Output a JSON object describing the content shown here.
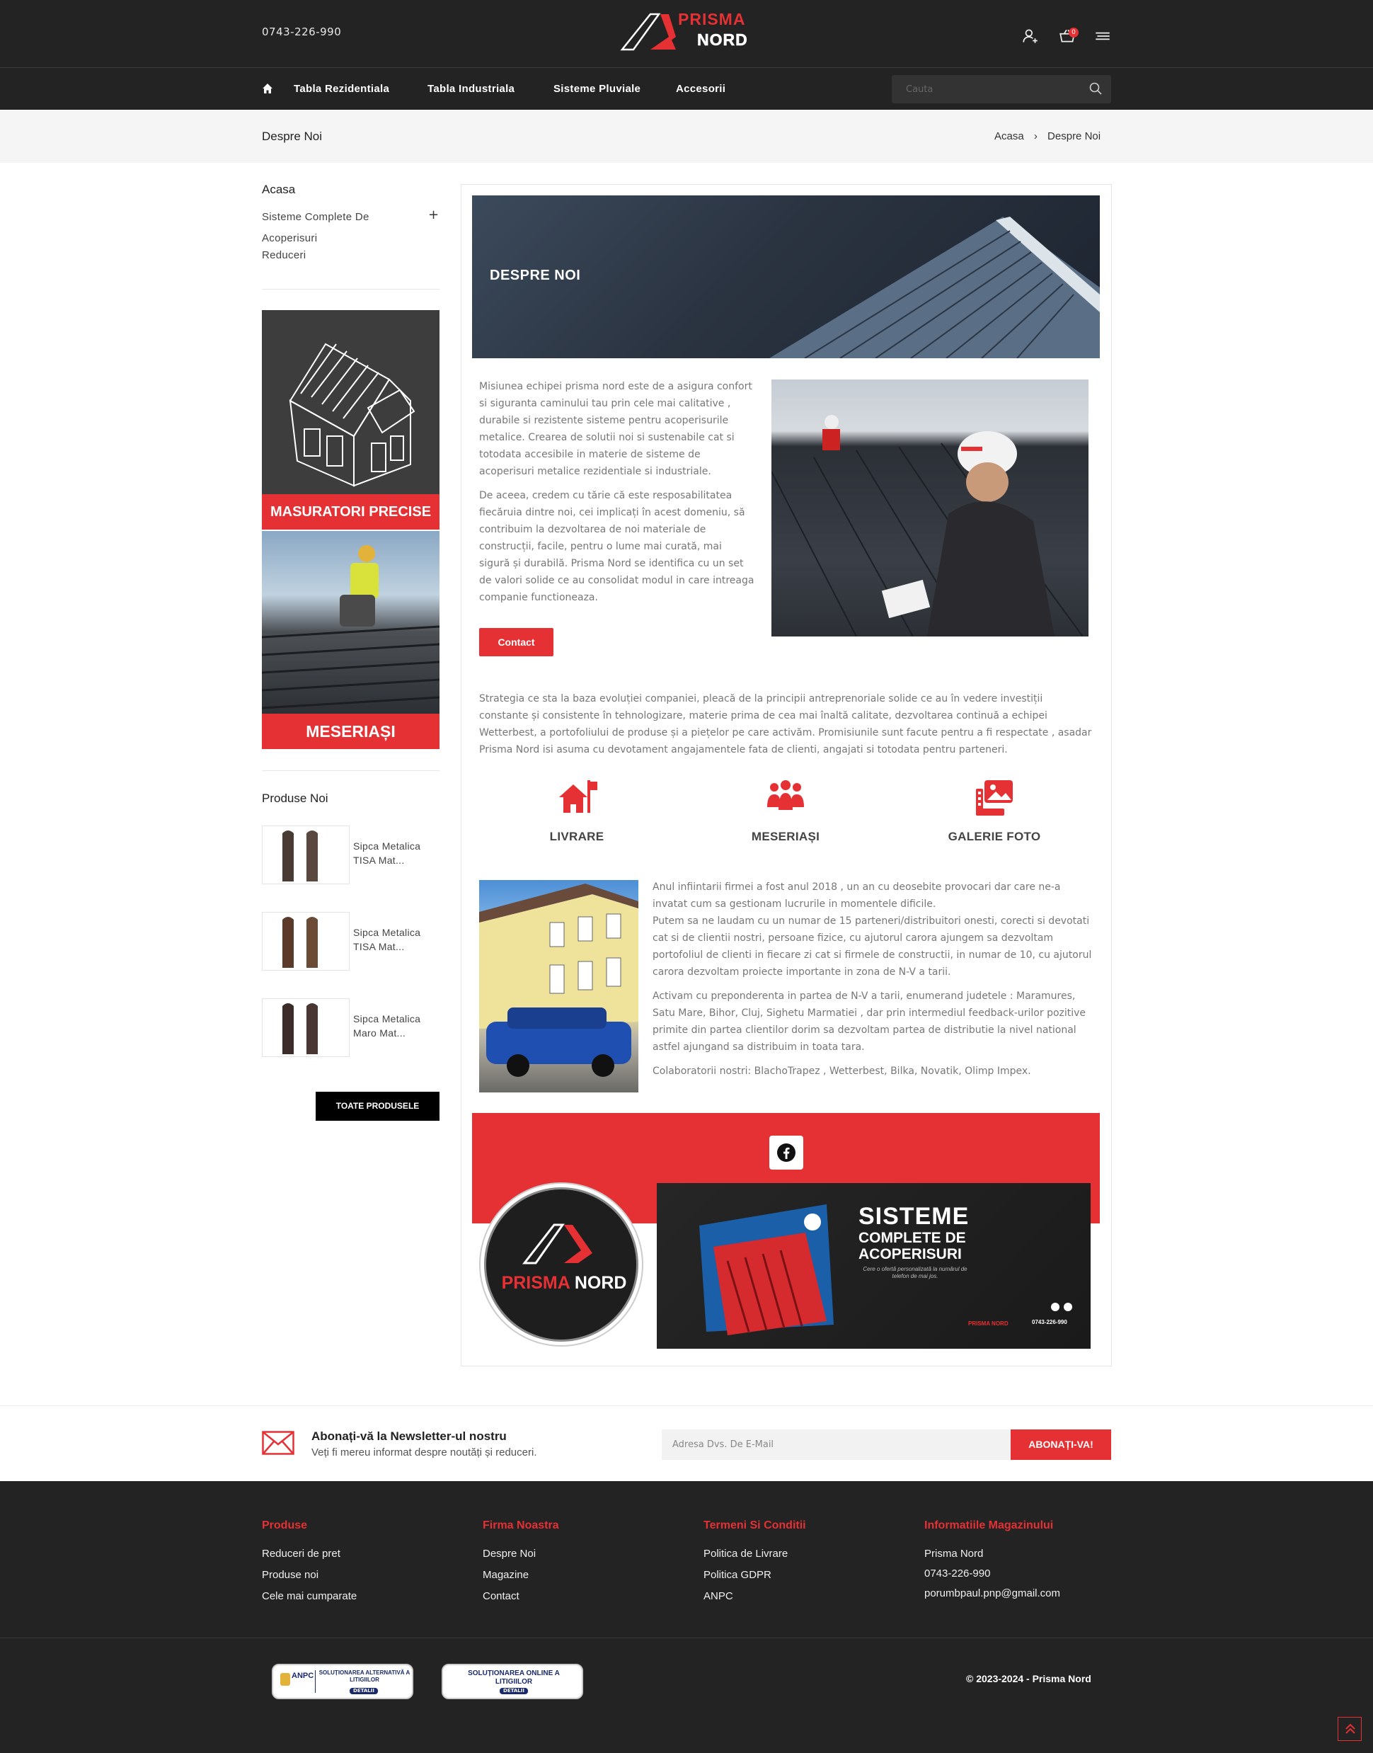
{
  "header": {
    "phone": "0743-226-990",
    "logo_word1": "PRISMA",
    "logo_word2": "NORD",
    "cart_count": "0",
    "icons": [
      "user-add-icon",
      "cart-icon",
      "menu-icon"
    ]
  },
  "nav": {
    "home_icon": "home-icon",
    "items": [
      "Tabla Rezidentiala",
      "Tabla Industriala",
      "Sisteme Pluviale",
      "Accesorii"
    ],
    "search_placeholder": "Cauta"
  },
  "breadcrumb": {
    "title": "Despre Noi",
    "home": "Acasa",
    "separator": "›",
    "current": "Despre Noi"
  },
  "sidebar": {
    "heading": "Acasa",
    "links": [
      "Sisteme Complete De Acoperisuri",
      "Reduceri"
    ],
    "expand_symbol": "+",
    "banner1_label": "MASURATORI PRECISE",
    "banner2_label": "MESERIAȘI",
    "new_products_heading": "Produse Noi",
    "products": [
      {
        "name": "Sipca Metalica TISA Mat..."
      },
      {
        "name": "Sipca Metalica TISA Mat..."
      },
      {
        "name": "Sipca Metalica Maro Mat..."
      }
    ],
    "all_products_button": "TOATE PRODUSELE"
  },
  "content": {
    "hero_title": "DESPRE NOI",
    "para1": "Misiunea echipei prisma nord este de a asigura confort si siguranta caminului tau prin cele mai calitative , durabile si rezistente sisteme pentru acoperisurile metalice. Crearea de solutii noi si sustenabile cat si totodata accesibile in materie de sisteme de acoperisuri metalice rezidentiale si industriale.",
    "para2": "De aceea, credem cu tărie că este resposabilitatea fiecăruia dintre noi, cei implicați în acest domeniu, să contribuim la dezvoltarea de noi materiale de construcții, facile, pentru o lume mai curată, mai sigură și durabilă. Prisma Nord se identifica cu un set de valori solide ce au consolidat modul in care intreaga companie functioneaza.",
    "contact_button": "Contact",
    "strategy": "Strategia ce sta la baza evoluției companiei, pleacă de la principii antreprenoriale solide ce au în vedere investiții constante și consistente în tehnologizare, materie prima de cea mai înaltă calitate, dezvoltarea continuă a echipei Wetterbest, a portofoliului de produse și a piețelor pe care activăm. Promisiunile sunt facute pentru a fi respectate , asadar Prisma Nord isi asuma cu devotament angajamentele fata de clienti, angajati si totodata pentru parteneri.",
    "features": [
      {
        "label": "LIVRARE",
        "icon": "delivery-house-icon"
      },
      {
        "label": "MESERIAȘI",
        "icon": "team-icon"
      },
      {
        "label": "GALERIE FOTO",
        "icon": "gallery-icon"
      }
    ],
    "history_p1": "Anul infiintarii firmei a fost anul 2018 , un an cu deosebite provocari dar care ne-a invatat cum sa gestionam lucrurile in momentele dificile.",
    "history_p2": "Putem sa ne laudam cu un numar de 15 parteneri/distribuitori onesti, corecti si devotati cat si de clientii nostri, persoane fizice, cu ajutorul carora ajungem sa dezvoltam portofoliul de clienti in fiecare zi cat si firmele de constructii, in numar de 10, cu ajutorul carora dezvoltam proiecte importante in zona de N-V a tarii.",
    "history_p3": "Activam cu preponderenta in partea de N-V a tarii, enumerand judetele : Maramures, Satu Mare, Bihor, Cluj, Sighetu Marmatiei , dar prin intermediul feedback-urilor pozitive primite din partea clientilor dorim sa dezvoltam partea de distributie la nivel national astfel ajungand sa distribuim in toata tara.",
    "history_p4": "Colaboratorii nostri: BlachoTrapez , Wetterbest, Bilka, Novatik, Olimp Impex.",
    "social_icon": "facebook-icon",
    "circle_logo_word1": "PRISMA",
    "circle_logo_word2": "NORD",
    "promo_line1": "SISTEME",
    "promo_line2": "COMPLETE DE",
    "promo_line3": "ACOPERISURI",
    "promo_sub": "Cere o ofertă personalizată la numărul de telefon de mai jos.",
    "promo_brand": "PRISMA NORD",
    "promo_phone": "0743-226-990"
  },
  "newsletter": {
    "title": "Abonați-vă la Newsletter-ul nostru",
    "subtitle": "Veți fi mereu informat despre noutăți și reduceri.",
    "placeholder": "Adresa Dvs. De E-Mail",
    "button": "ABONAȚI-VA!"
  },
  "footer": {
    "columns": [
      {
        "heading": "Produse",
        "links": [
          "Reduceri de pret",
          "Produse noi",
          "Cele mai cumparate"
        ]
      },
      {
        "heading": "Firma Noastra",
        "links": [
          "Despre Noi",
          "Magazine",
          "Contact"
        ]
      },
      {
        "heading": "Termeni Si Conditii",
        "links": [
          "Politica de Livrare",
          "Politica GDPR",
          "ANPC"
        ]
      },
      {
        "heading": "Informatiile Magazinului",
        "links": [
          "Prisma Nord",
          "0743-226-990",
          "porumbpaul.pnp@gmail.com"
        ]
      }
    ],
    "anpc1_text": "SOLUȚIONAREA ALTERNATIVĂ A LITIGIILOR",
    "anpc1_badge": "ANPC",
    "anpc2_text": "SOLUȚIONAREA ONLINE A LITIGIILOR",
    "anpc_detail": "DETALII",
    "copyright": "© 2023-2024 - Prisma Nord",
    "back_to_top_icon": "double-chevron-up-icon"
  },
  "colors": {
    "accent": "#e53034",
    "dark": "#232323"
  }
}
